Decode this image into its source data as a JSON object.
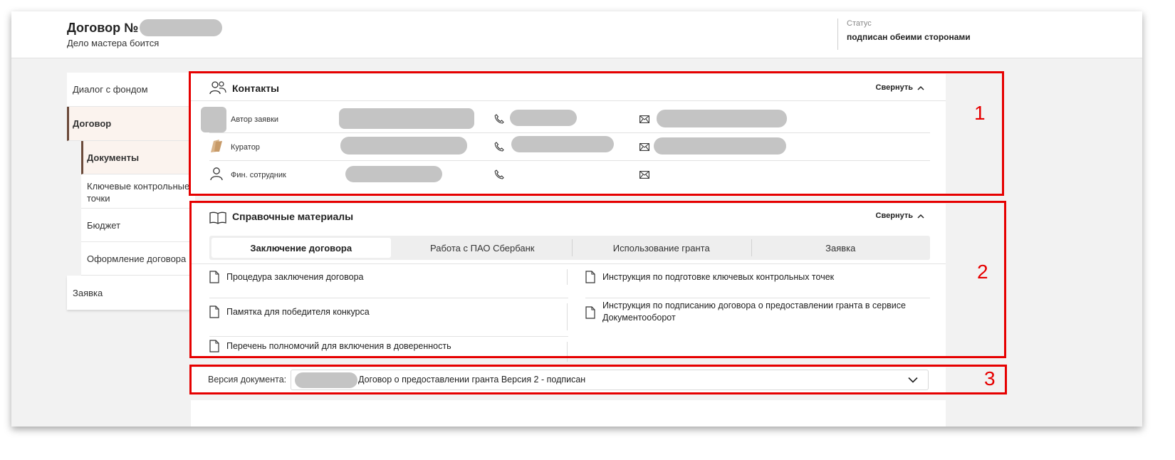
{
  "header": {
    "title": "Договор №",
    "subtitle": "Дело мастера боится",
    "status_label": "Статус",
    "status_value": "подписан обеими сторонами"
  },
  "sidebar": {
    "items": [
      {
        "label": "Диалог с фондом"
      },
      {
        "label": "Договор"
      },
      {
        "label": "Документы"
      },
      {
        "label": "Ключевые контрольные точки"
      },
      {
        "label": "Бюджет"
      },
      {
        "label": "Оформление договора"
      },
      {
        "label": "Заявка"
      }
    ]
  },
  "contacts": {
    "title": "Контакты",
    "collapse_label": "Свернуть",
    "rows": [
      {
        "role": "Автор заявки",
        "icon": "avatar-icon"
      },
      {
        "role": "Куратор",
        "icon": "curator-icon"
      },
      {
        "role": "Фин. сотрудник",
        "icon": "person-icon"
      }
    ]
  },
  "reference": {
    "title": "Справочные материалы",
    "collapse_label": "Свернуть",
    "tabs": [
      {
        "label": "Заключение договора"
      },
      {
        "label": "Работа с ПАО Сбербанк"
      },
      {
        "label": "Использование гранта"
      },
      {
        "label": "Заявка"
      }
    ],
    "documents": [
      {
        "label": "Процедура заключения договора"
      },
      {
        "label": "Инструкция по подготовке ключевых контрольных точек"
      },
      {
        "label": "Памятка для победителя конкурса"
      },
      {
        "label": "Инструкция по подписанию договора о предоставлении гранта в сервисе Документооборот"
      },
      {
        "label": "Перечень полномочий для включения в доверенность"
      }
    ]
  },
  "version": {
    "label": "Версия документа:",
    "value": "Договор о предоставлении гранта Версия 2 - подписан"
  },
  "annotations": [
    "1",
    "2",
    "3"
  ],
  "colors": {
    "accent": "#6b4a3a",
    "highlight": "#e60000",
    "active_bg": "#fbf3ee"
  }
}
